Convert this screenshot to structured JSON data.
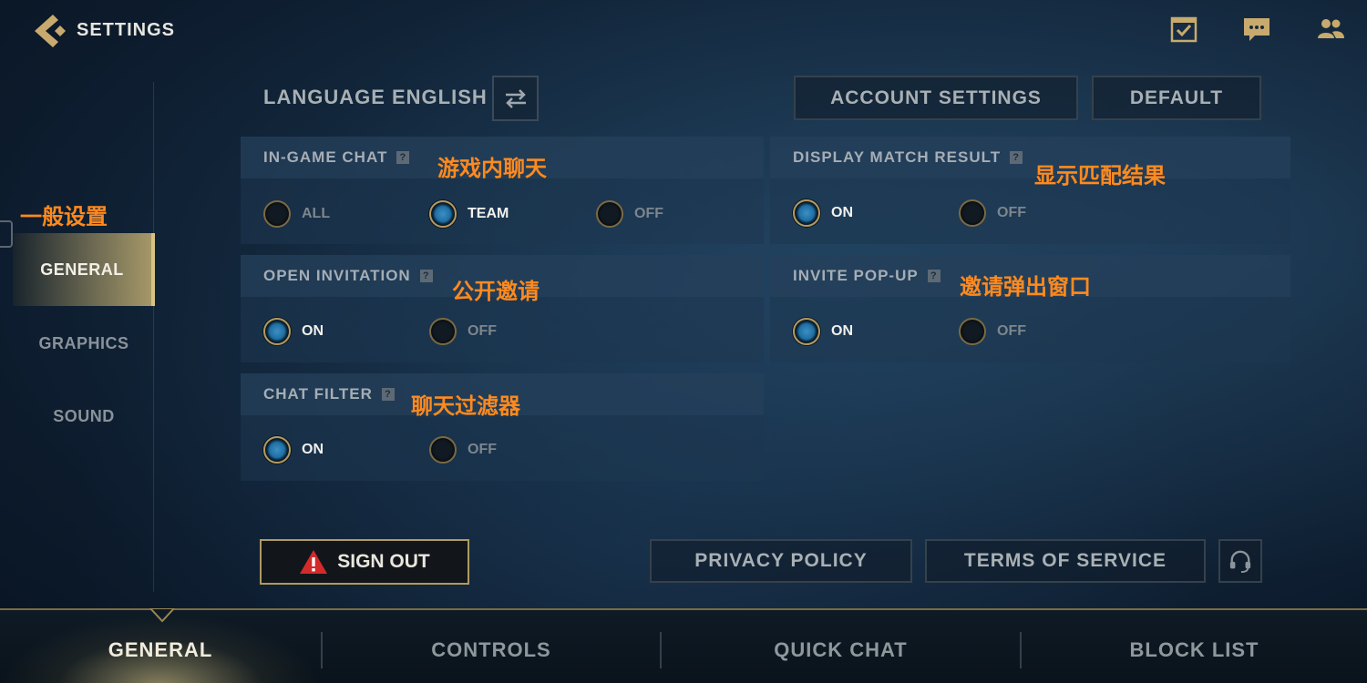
{
  "header": {
    "title": "SETTINGS",
    "icons": [
      "back-arrow-icon",
      "checklist-icon",
      "chat-bubble-icon",
      "friends-icon"
    ]
  },
  "sidebar": {
    "annotation": "一般设置",
    "items": [
      {
        "label": "GENERAL",
        "active": true
      },
      {
        "label": "GRAPHICS",
        "active": false
      },
      {
        "label": "SOUND",
        "active": false
      }
    ]
  },
  "language": {
    "label": "LANGUAGE ENGLISH"
  },
  "account_settings_label": "ACCOUNT SETTINGS",
  "default_label": "DEFAULT",
  "panels": {
    "in_game_chat": {
      "title": "IN-GAME CHAT",
      "annotation": "游戏内聊天",
      "options": [
        "ALL",
        "TEAM",
        "OFF"
      ],
      "selected": "TEAM"
    },
    "display_match_result": {
      "title": "DISPLAY MATCH RESULT",
      "annotation": "显示匹配结果",
      "options": [
        "ON",
        "OFF"
      ],
      "selected": "ON"
    },
    "open_invitation": {
      "title": "OPEN INVITATION",
      "annotation": "公开邀请",
      "options": [
        "ON",
        "OFF"
      ],
      "selected": "ON"
    },
    "invite_popup": {
      "title": "INVITE POP-UP",
      "annotation": "邀请弹出窗口",
      "options": [
        "ON",
        "OFF"
      ],
      "selected": "ON"
    },
    "chat_filter": {
      "title": "CHAT FILTER",
      "annotation": "聊天过滤器",
      "options": [
        "ON",
        "OFF"
      ],
      "selected": "ON"
    }
  },
  "help_glyph": "?",
  "footer": {
    "sign_out": "SIGN OUT",
    "privacy_policy": "PRIVACY POLICY",
    "terms_of_service": "TERMS OF SERVICE"
  },
  "tabs": [
    {
      "label": "GENERAL",
      "active": true
    },
    {
      "label": "CONTROLS",
      "active": false
    },
    {
      "label": "QUICK CHAT",
      "active": false
    },
    {
      "label": "BLOCK LIST",
      "active": false
    }
  ],
  "colors": {
    "gold": "#c8aa6e",
    "annotation_orange": "#ff8a1e",
    "radio_on_blue": "#1f6fa3",
    "warning_red": "#d42a2a"
  }
}
